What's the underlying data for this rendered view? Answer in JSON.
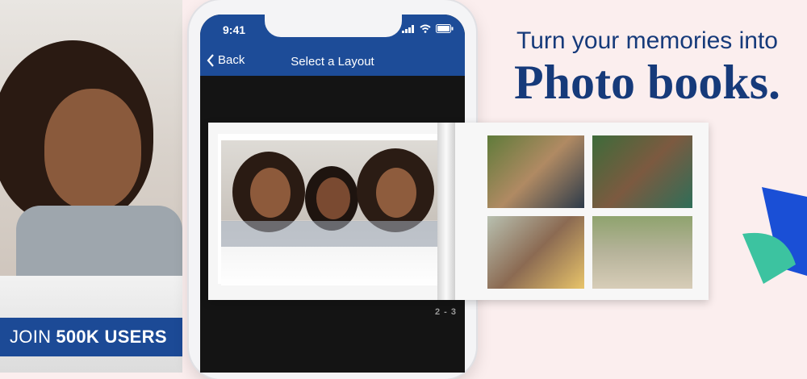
{
  "badge": {
    "prefix": "JOIN",
    "emphasis": "500K USERS"
  },
  "phone": {
    "status_time": "9:41",
    "nav": {
      "back_label": "Back",
      "title": "Select a Layout"
    },
    "page_indicator": "2 - 3"
  },
  "headline": {
    "line1": "Turn your memories into",
    "line2": "Photo books."
  },
  "colors": {
    "brand_blue": "#1d4c98",
    "headline_blue": "#163a7a",
    "accent_teal": "#3cc3a0",
    "accent_blue": "#1a4fd6"
  },
  "icons": [
    "chevron-left-icon",
    "signal-icon",
    "wifi-icon",
    "battery-icon"
  ]
}
